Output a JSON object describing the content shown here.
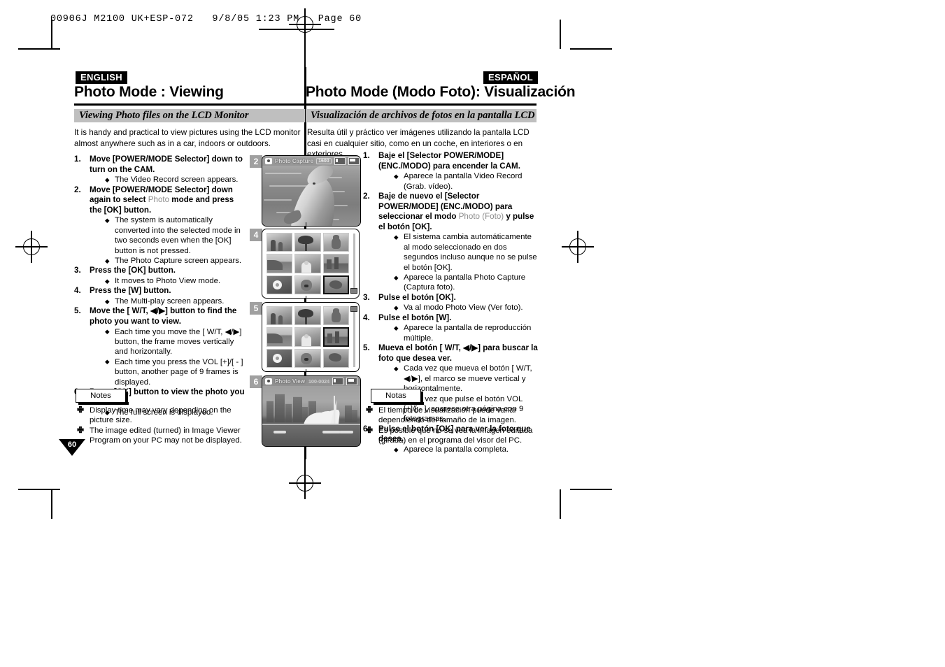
{
  "slug": {
    "text": "00906J M2100 UK+ESP-072   9/8/05 1:23 PM   Page 60"
  },
  "page_number": "60",
  "columns": {
    "english": {
      "language_badge": "ENGLISH",
      "chapter_title": "Photo Mode : Viewing",
      "section_bar": "Viewing Photo files on the LCD Monitor",
      "intro": "It is handy and practical to view pictures using the LCD monitor almost anywhere such as in a car, indoors or outdoors.",
      "steps": [
        {
          "num": "1.",
          "text_pre": "Move [POWER/MODE Selector] down to turn on the CAM.",
          "grey": "",
          "text_post": "",
          "bullets": [
            "The Video Record screen appears."
          ]
        },
        {
          "num": "2.",
          "text_pre": "Move [POWER/MODE Selector] down again to select ",
          "grey": "Photo",
          "text_post": " mode and press the [OK] button.",
          "bullets": [
            "The system is automatically converted into the selected mode in two seconds even when the [OK] button is not pressed.",
            "The Photo Capture screen appears."
          ]
        },
        {
          "num": "3.",
          "text_pre": "Press the [OK] button.",
          "grey": "",
          "text_post": "",
          "bullets": [
            "It moves to Photo View mode."
          ]
        },
        {
          "num": "4.",
          "text_pre": "Press the [W] button.",
          "grey": "",
          "text_post": "",
          "bullets": [
            "The Multi-play screen appears."
          ]
        },
        {
          "num": "5.",
          "text_pre": "Move the [ W/T, ◀/▶] button to find the photo you want to view.",
          "grey": "",
          "text_post": "",
          "bullets": [
            "Each time you move the [ W/T, ◀/▶] button, the frame moves vertically and horizontally.",
            "Each time you press the VOL [+]/[ - ] button, another page of 9 frames is displayed."
          ]
        },
        {
          "num": "6.",
          "text_pre": "Press [OK] button to view the photo you want.",
          "grey": "",
          "text_post": "",
          "bullets": [
            "The full screen is displayed."
          ]
        }
      ],
      "notes_label": "Notes",
      "notes": [
        "Display time may vary depending on the picture size.",
        "The image edited (turned) in Image Viewer Program on your PC may not be displayed."
      ]
    },
    "spanish": {
      "language_badge": "ESPAÑOL",
      "chapter_title": "Photo Mode (Modo Foto): Visualización",
      "section_bar": "Visualización de archivos de fotos en la pantalla LCD",
      "intro": "Resulta útil y práctico ver imágenes utilizando la pantalla LCD casi en cualquier sitio, como en un coche, en interiores o en exteriores.",
      "steps": [
        {
          "num": "1.",
          "text_pre": "Baje el [Selector POWER/MODE] (ENC./MODO) para encender la CAM.",
          "grey": "",
          "text_post": "",
          "bullets": [
            "Aparece la pantalla Video Record (Grab. vídeo)."
          ]
        },
        {
          "num": "2.",
          "text_pre": "Baje de nuevo el [Selector POWER/MODE] (ENC./MODO) para seleccionar el modo ",
          "grey": "Photo (Foto)",
          "text_post": " y pulse el botón [OK].",
          "bullets": [
            "El sistema cambia automáticamente al modo seleccionado en dos segundos incluso aunque no se pulse el botón [OK].",
            "Aparece la pantalla Photo Capture (Captura foto)."
          ]
        },
        {
          "num": "3.",
          "text_pre": "Pulse el botón [OK].",
          "grey": "",
          "text_post": "",
          "bullets": [
            "Va al modo Photo View (Ver foto)."
          ]
        },
        {
          "num": "4.",
          "text_pre": "Pulse el botón [W].",
          "grey": "",
          "text_post": "",
          "bullets": [
            "Aparece la pantalla de reproducción múltiple."
          ]
        },
        {
          "num": "5.",
          "text_pre": "Mueva el botón [ W/T, ◀/▶] para buscar la foto que desea ver.",
          "grey": "",
          "text_post": "",
          "bullets": [
            "Cada vez que mueva el botón [ W/T, ◀/▶], el marco se mueve vertical y horizontalmente.",
            "Cada vez que pulse el botón VOL [+]/[ - ], aparece otra página con 9 fotogramas."
          ]
        },
        {
          "num": "6.",
          "text_pre": "Pulse el botón [OK] para ver la foto que desea.",
          "grey": "",
          "text_post": "",
          "bullets": [
            "Aparece la pantalla completa."
          ]
        }
      ],
      "notes_label": "Notas",
      "notes": [
        "El tiempo de visualización puede variar dependiendo del tamaño de la imagen.",
        "Es posible que no se vea la imagen editada (girada) en el programa del visor del PC."
      ]
    }
  },
  "illustrations": [
    {
      "index": "2",
      "kind": "fullscreen",
      "scene": "dolphin",
      "osd_title": "Photo Capture",
      "osd_badge": "1600",
      "osd_filename": ""
    },
    {
      "index": "4",
      "kind": "multiplay",
      "selected_cell": 8,
      "scroll_position": "bottom",
      "thumbs": [
        "people",
        "palm",
        "cat",
        "coast",
        "group",
        "city",
        "flower",
        "dog",
        "dolphin"
      ]
    },
    {
      "index": "5",
      "kind": "multiplay",
      "selected_cell": 5,
      "scroll_position": "top",
      "thumbs": [
        "people",
        "palm",
        "cat",
        "coast",
        "group",
        "city",
        "flower",
        "dog",
        "dolphin"
      ]
    },
    {
      "index": "6",
      "kind": "fullscreen",
      "scene": "city",
      "osd_title": "Photo View",
      "osd_badge": "",
      "osd_filename": "100-0024"
    }
  ],
  "colors": {
    "section_bar_bg": "#bfbfbf",
    "badge_bg": "#000000",
    "index_badge_bg": "#a0a0a0",
    "grey_inline_text": "#8c8c8c"
  }
}
